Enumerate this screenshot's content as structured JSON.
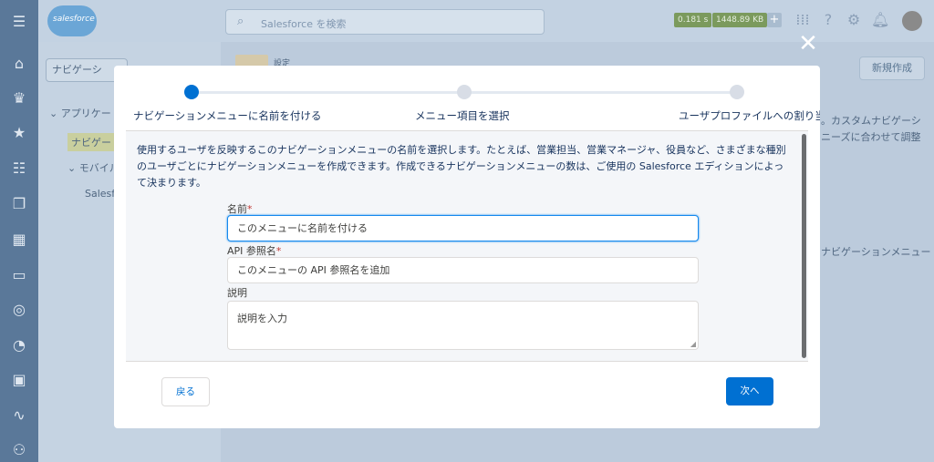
{
  "app": {
    "logo_text": "salesforce",
    "search_placeholder": "Salesforce を検索",
    "perf_time": "0.181 s",
    "perf_size": "1448.89 KB"
  },
  "background": {
    "left_search": "ナビゲーシ",
    "tree_apps": "アプリケー",
    "tree_nav": "ナビゲー",
    "tree_mobile": "モバイル",
    "tree_salesforce": "Salesforc",
    "breadcrumb": "設定",
    "new_button": "新規作成",
    "side_text_1": "。カスタムナビゲーシ",
    "side_text_2": "ニーズに合わせて調整",
    "side_text_3": "ナビゲーションメニュー"
  },
  "wizard": {
    "steps": [
      {
        "label": "ナビゲーションメニューに名前を付ける",
        "active": true
      },
      {
        "label": "メニュー項目を選択",
        "active": false
      },
      {
        "label": "ユーザプロファイルへの割り当",
        "active": false
      }
    ],
    "description": "使用するユーザを反映するこのナビゲーションメニューの名前を選択します。たとえば、営業担当、営業マネージャ、役員など、さまざまな種別のユーザごとにナビゲーションメニューを作成できます。作成できるナビゲーションメニューの数は、ご使用の Salesforce エディションによって決まります。",
    "name_label": "名前",
    "name_placeholder": "このメニューに名前を付ける",
    "api_label": "API 参照名",
    "api_placeholder": "このメニューの API 参照名を追加",
    "desc_label": "説明",
    "desc_placeholder": "説明を入力",
    "required_mark": "*",
    "back_button": "戻る",
    "next_button": "次へ"
  }
}
